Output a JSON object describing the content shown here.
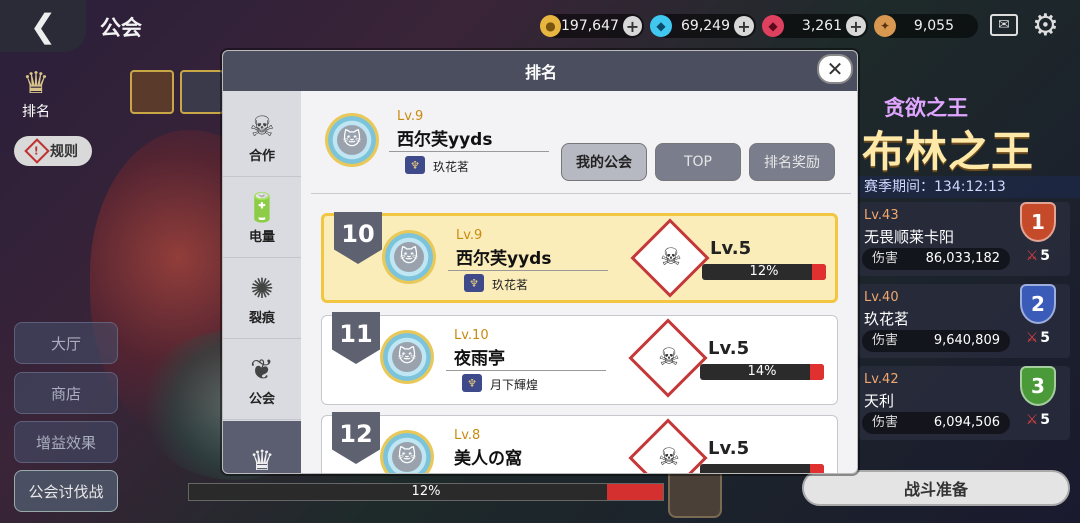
{
  "topbar": {
    "title": "公会",
    "resources": [
      {
        "icon": "gold-coin-icon",
        "value": "197,647",
        "color": "#e8b640"
      },
      {
        "icon": "diamond-icon",
        "value": "69,249",
        "color": "#40c8f0"
      },
      {
        "icon": "ruby-icon",
        "value": "3,261",
        "color": "#e04060"
      },
      {
        "icon": "medal-coin-icon",
        "value": "9,055",
        "color": "#d89850"
      }
    ]
  },
  "left": {
    "ranking_label": "排名",
    "rules_label": "规则",
    "nav": [
      "大厅",
      "商店",
      "增益效果",
      "公会讨伐战"
    ]
  },
  "bottom": {
    "progress_label": "12%",
    "progress": 0.12
  },
  "event": {
    "subtitle": "贪欲之王",
    "title": "布林之王",
    "season": "赛季期间：134:12:13"
  },
  "rank_cards": [
    {
      "lv": "Lv.43",
      "name": "无畏顺莱卡阳",
      "dmg_label": "伤害",
      "dmg": "86,033,182",
      "rank": "1",
      "swords": "5",
      "color": "#c44a2a"
    },
    {
      "lv": "Lv.40",
      "name": "玖花茗",
      "dmg_label": "伤害",
      "dmg": "9,640,809",
      "rank": "2",
      "swords": "5",
      "color": "#3a5cb8"
    },
    {
      "lv": "Lv.42",
      "name": "天利",
      "dmg_label": "伤害",
      "dmg": "6,094,506",
      "rank": "3",
      "swords": "5",
      "color": "#4a9a3a"
    }
  ],
  "battle_label": "战斗准备",
  "modal": {
    "title": "排名",
    "close": "✕",
    "side_tabs": [
      "合作",
      "电量",
      "裂痕",
      "公会"
    ],
    "me": {
      "lv": "Lv.9",
      "name": "西尔芙yyds",
      "guild": "玖花茗"
    },
    "tabs": [
      "我的公会",
      "TOP",
      "排名奖励"
    ],
    "entries": [
      {
        "rank": "10",
        "lv": "Lv.9",
        "name": "西尔芙yyds",
        "guild": "玖花茗",
        "boss_lv": "Lv.5",
        "pct": "12%",
        "progress": 0.12
      },
      {
        "rank": "11",
        "lv": "Lv.10",
        "name": "夜雨亭",
        "guild": "月下輝煌",
        "boss_lv": "Lv.5",
        "pct": "14%",
        "progress": 0.14
      },
      {
        "rank": "12",
        "lv": "Lv.8",
        "name": "美人の窩",
        "guild": "",
        "boss_lv": "Lv.5",
        "pct": "",
        "progress": 0.12
      }
    ]
  }
}
